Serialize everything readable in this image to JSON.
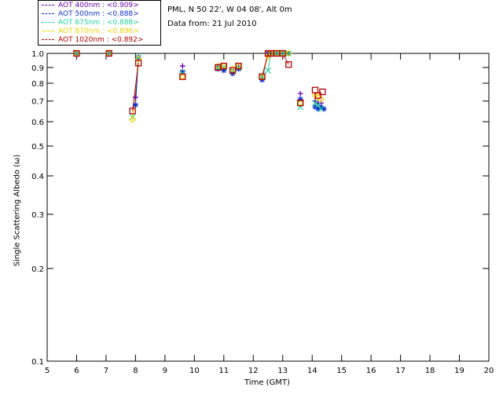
{
  "info": {
    "site": "PML, N 50 22', W 04 08', Alt 0m",
    "date": "Data from: 21 Jul 2010"
  },
  "chart_data": {
    "type": "scatter",
    "xlabel": "Time (GMT)",
    "ylabel": "Single Scattering Albedo (ω)",
    "xlim": [
      5,
      20
    ],
    "ylim": [
      0.1,
      1.0
    ],
    "yscale": "log",
    "xticks": [
      "5",
      "6",
      "7",
      "8",
      "9",
      "10",
      "11",
      "12",
      "13",
      "14",
      "15",
      "16",
      "17",
      "18",
      "19",
      "20"
    ],
    "yticks": [
      {
        "v": 1.0,
        "label": "1.0"
      },
      {
        "v": 0.9,
        "label": "0.9"
      },
      {
        "v": 0.8,
        "label": "0.8"
      },
      {
        "v": 0.7,
        "label": "0.7"
      },
      {
        "v": 0.6,
        "label": "0.6"
      },
      {
        "v": 0.5,
        "label": "0.5"
      },
      {
        "v": 0.4,
        "label": "0.4"
      },
      {
        "v": 0.3,
        "label": "0.3"
      },
      {
        "v": 0.2,
        "label": "0.2"
      },
      {
        "v": 0.1,
        "label": "0.1"
      }
    ],
    "grid": false,
    "legend_position": "top-left",
    "series": [
      {
        "label": "AOT  400nm : <0.909>",
        "color": "#6a00a8",
        "marker": "plus",
        "x": [
          6.0,
          7.1,
          8.0,
          8.1,
          9.6,
          10.8,
          11.0,
          11.3,
          11.5,
          12.3,
          12.5,
          12.6,
          12.8,
          13.0,
          13.2,
          13.6,
          14.1,
          14.2,
          14.3
        ],
        "y": [
          1.0,
          1.0,
          0.72,
          0.97,
          0.91,
          0.9,
          0.89,
          0.87,
          0.9,
          0.83,
          1.0,
          1.0,
          1.0,
          1.0,
          1.0,
          0.74,
          0.7,
          0.69,
          0.69
        ]
      },
      {
        "label": "AOT  500nm : <0.888>",
        "color": "#1030c8",
        "marker": "asterisk",
        "x": [
          6.0,
          7.1,
          8.0,
          8.1,
          9.6,
          10.8,
          11.0,
          11.3,
          11.5,
          12.3,
          12.5,
          12.6,
          12.8,
          13.0,
          13.2,
          13.6,
          14.1,
          14.2,
          14.3,
          14.4
        ],
        "y": [
          1.0,
          1.0,
          0.68,
          0.97,
          0.87,
          0.89,
          0.88,
          0.86,
          0.89,
          0.82,
          1.0,
          1.0,
          1.0,
          1.0,
          1.0,
          0.71,
          0.67,
          0.66,
          0.67,
          0.66
        ]
      },
      {
        "label": "AOT  675nm : <0.888>",
        "color": "#20d0a0",
        "marker": "cross",
        "x": [
          6.0,
          7.1,
          7.9,
          8.1,
          9.6,
          10.8,
          11.0,
          11.3,
          11.5,
          12.3,
          12.5,
          12.6,
          12.8,
          13.0,
          13.2,
          13.6,
          14.1,
          14.2,
          14.3
        ],
        "y": [
          1.0,
          1.0,
          0.62,
          0.97,
          0.86,
          0.9,
          0.9,
          0.88,
          0.9,
          0.84,
          0.88,
          1.0,
          1.0,
          1.0,
          1.0,
          0.67,
          0.69,
          0.68,
          0.66
        ]
      },
      {
        "label": "AOT  870nm : <0.896>",
        "color": "#f0d000",
        "marker": "diamond",
        "x": [
          6.0,
          7.1,
          7.9,
          8.1,
          9.6,
          10.8,
          11.0,
          11.3,
          11.5,
          12.3,
          12.5,
          12.6,
          12.8,
          13.0,
          13.2,
          13.6,
          14.1,
          14.2,
          14.3
        ],
        "y": [
          1.0,
          1.0,
          0.61,
          0.96,
          0.84,
          0.91,
          0.91,
          0.89,
          0.91,
          0.84,
          0.98,
          1.0,
          1.0,
          1.0,
          1.0,
          0.69,
          0.73,
          0.72,
          0.71
        ]
      },
      {
        "label": "AOT 1020nm : <0.892>",
        "color": "#b00000",
        "marker": "square",
        "x": [
          6.0,
          7.1,
          7.9,
          8.1,
          9.6,
          10.8,
          11.0,
          11.3,
          11.5,
          12.3,
          12.5,
          12.6,
          12.8,
          13.0,
          13.2,
          13.6,
          14.1,
          14.2,
          14.35
        ],
        "y": [
          1.0,
          1.0,
          0.65,
          0.93,
          0.84,
          0.9,
          0.91,
          0.88,
          0.91,
          0.84,
          1.0,
          1.0,
          1.0,
          1.0,
          0.92,
          0.69,
          0.76,
          0.73,
          0.75
        ]
      }
    ],
    "line_segments": [
      [
        7.9,
        8.1
      ],
      [
        12.3,
        12.6
      ],
      [
        13.0,
        13.2
      ]
    ]
  }
}
